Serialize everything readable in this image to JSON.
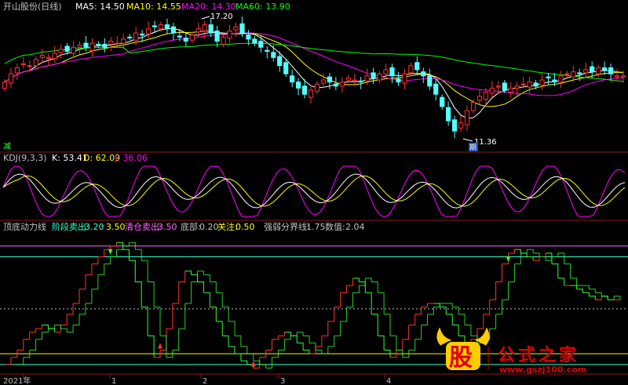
{
  "colors": {
    "background": "#000000",
    "divider": "#8b1a1a",
    "up": "#ff3232",
    "down": "#54ffff",
    "ma5": "#ffffff",
    "ma10": "#ffff00",
    "ma20": "#ff00ff",
    "ma60": "#00ff00",
    "k": "#ffffff",
    "d": "#ffff00",
    "j": "#ff00ff",
    "stairs_up": "#ff3232",
    "stairs_down": "#33ff33",
    "level_line": "#33ffcc",
    "watermark_red": "#e00000",
    "watermark_yellow": "#ffcc00"
  },
  "header": {
    "stock_title": "开山股份(日线)",
    "ma5_label": "MA5: 14.50",
    "ma10_label": "MA10: 14.55",
    "ma20_label": "MA20: 14.30",
    "ma60_label": "MA60: 13.90"
  },
  "annotations": {
    "high_label": "17.20",
    "low_label": "11.36",
    "low_marker": "期",
    "reduce_badge": "减"
  },
  "kdj": {
    "title": "KDJ(9,3,3)",
    "k_label": "K: 53.41",
    "d_label": "D: 62.09",
    "j_label": "J: 36.06"
  },
  "indicator": {
    "name": "顶底动力线",
    "stage_sell_label": "阶段卖出:",
    "stage_sell_value": "3.20",
    "stage_sell_value2": "3.50",
    "clear_sell_label": "清仓卖出:",
    "clear_sell_value": "3.50",
    "bottom_label": "底部:",
    "bottom_value": "0.20",
    "watch_label": "关注:",
    "watch_value": "0.50",
    "strength_label": "强弱分界线:",
    "strength_value": "1.75",
    "value_label": "数值:",
    "value_value": "2.04"
  },
  "x_axis": {
    "ticks": [
      "2021年",
      "1",
      "2",
      "3",
      "4"
    ]
  },
  "watermark": {
    "logo_char": "股",
    "text": "公式之家",
    "url": "www.gszj100.com"
  },
  "chart_data": [
    {
      "type": "candlestick",
      "title": "开山股份(日线)",
      "annotations": [
        {
          "label": "17.20",
          "kind": "high"
        },
        {
          "label": "11.36",
          "kind": "low"
        }
      ],
      "series": [
        {
          "name": "MA5",
          "last": 14.5
        },
        {
          "name": "MA10",
          "last": 14.55
        },
        {
          "name": "MA20",
          "last": 14.3
        },
        {
          "name": "MA60",
          "last": 13.9
        }
      ],
      "close": [
        14.2,
        14.6,
        14.9,
        15.1,
        15.0,
        15.3,
        15.5,
        15.4,
        15.6,
        15.8,
        15.7,
        15.9,
        16.0,
        15.9,
        16.1,
        16.0,
        15.9,
        16.2,
        16.1,
        16.3,
        16.4,
        16.6,
        16.5,
        16.8,
        16.9,
        17.0,
        16.8,
        16.6,
        16.4,
        16.2,
        16.5,
        16.8,
        17.0,
        16.6,
        16.2,
        16.4,
        16.7,
        16.9,
        16.6,
        16.3,
        16.1,
        15.9,
        15.7,
        15.4,
        15.0,
        14.6,
        14.2,
        13.9,
        13.6,
        13.8,
        14.1,
        14.3,
        14.2,
        14.0,
        14.2,
        14.4,
        14.3,
        14.2,
        14.5,
        14.4,
        14.6,
        14.8,
        14.5,
        14.2,
        14.6,
        15.0,
        14.8,
        14.5,
        14.0,
        13.6,
        13.0,
        12.3,
        11.8,
        12.2,
        12.8,
        13.2,
        13.5,
        13.7,
        13.9,
        14.0,
        13.8,
        13.9,
        14.0,
        14.1,
        14.2,
        14.0,
        14.3,
        14.4,
        14.2,
        14.5,
        14.6,
        14.7,
        14.6,
        14.8,
        14.7,
        14.9,
        14.8,
        14.6,
        14.5,
        14.5
      ]
    },
    {
      "type": "line",
      "title": "KDJ(9,3,3)",
      "series": [
        {
          "name": "K",
          "last": 53.41
        },
        {
          "name": "D",
          "last": 62.09
        },
        {
          "name": "J",
          "last": 36.06
        }
      ]
    },
    {
      "type": "line",
      "title": "顶底动力线",
      "levels": {
        "stage_sell": [
          3.2,
          3.5
        ],
        "clear_sell": 3.5,
        "bottom": 0.2,
        "watch": 0.5,
        "strength_divider": 1.75
      },
      "last_value": 2.04,
      "ylim": [
        0,
        3.8
      ],
      "values": [
        0.2,
        0.4,
        0.6,
        0.9,
        1.1,
        1.2,
        1.3,
        1.2,
        1.1,
        1.3,
        1.6,
        1.9,
        2.3,
        2.7,
        3.0,
        3.2,
        3.4,
        3.5,
        3.6,
        3.4,
        3.1,
        2.5,
        1.8,
        1.0,
        0.4,
        0.6,
        1.2,
        1.9,
        2.5,
        2.8,
        2.7,
        2.5,
        2.2,
        1.8,
        1.4,
        1.0,
        0.7,
        0.5,
        0.3,
        0.2,
        0.1,
        0.4,
        0.6,
        0.9,
        1.0,
        1.1,
        1.0,
        0.8,
        0.6,
        0.5,
        0.7,
        1.0,
        1.4,
        1.8,
        2.2,
        2.4,
        2.6,
        2.5,
        2.2,
        1.6,
        1.0,
        0.6,
        0.4,
        0.6,
        0.9,
        1.3,
        1.6,
        1.8,
        1.9,
        1.9,
        1.8,
        1.6,
        1.3,
        1.0,
        0.8,
        0.9,
        1.2,
        1.6,
        2.0,
        2.5,
        3.0,
        3.3,
        3.4,
        3.3,
        3.2,
        3.1,
        3.2,
        3.3,
        3.0,
        2.6,
        2.4,
        2.4,
        2.3,
        2.2,
        2.1,
        2.0,
        2.1,
        2.0,
        2.0,
        2.04
      ]
    }
  ]
}
